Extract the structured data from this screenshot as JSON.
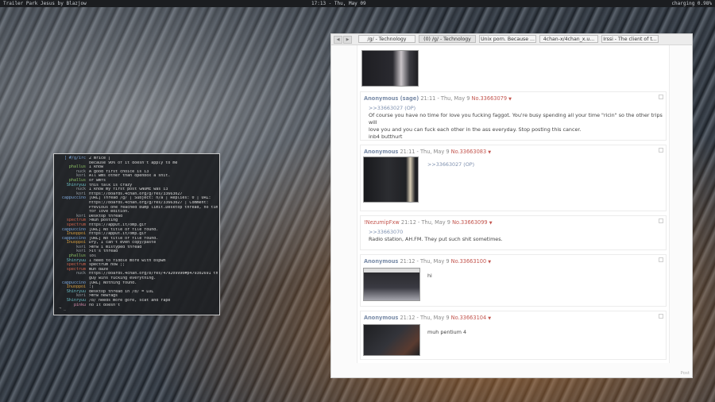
{
  "topbar": {
    "title": "Trailer Park Jesus by Blazjow",
    "clock": "17:13 - Thu, May 09",
    "battery": "charging 0.98%"
  },
  "terminal": {
    "header_nick": "[ ",
    "header_channel": "#/g/irc",
    "header_rest": " ]",
    "lines": [
      {
        "nick": "",
        "nick_color": "white",
        "text": "2 mrice ]"
      },
      {
        "nick": "",
        "nick_color": "white",
        "text": "because 90% of it doesn't apply to me"
      },
      {
        "nick": "phallus",
        "nick_color": "green",
        "text": "I know"
      },
      {
        "nick": "nuck",
        "nick_color": "gray",
        "text": "A good first choice is i3"
      },
      {
        "nick": "kori",
        "nick_color": "gray",
        "text": "All wms other than openbox a shit."
      },
      {
        "nick": "phallus",
        "nick_color": "green",
        "text": "or wmfs"
      },
      {
        "nick": "Shinryuu",
        "nick_color": "cyan",
        "text": "this talk is crazy"
      },
      {
        "nick": "nuck",
        "nick_color": "gray",
        "text": "I know my first post GNOME was i3"
      },
      {
        "nick": "kori",
        "nick_color": "gray",
        "text": "https://boards.4chan.org/g/res/33663027"
      },
      {
        "nick": "cappuccino",
        "nick_color": "blue",
        "text": "[URL] Thread /g/ | Subject: n/a | Replies: 0 | URL:"
      },
      {
        "nick": "",
        "nick_color": "white",
        "text": "https://boards.4chan.org/g/res/33663027 | Comment:"
      },
      {
        "nick": "",
        "nick_color": "white",
        "text": "Previous one reached bump limit.Desktop thread, no time"
      },
      {
        "nick": "",
        "nick_color": "white",
        "text": "for love edition."
      },
      {
        "nick": "kori",
        "nick_color": "gray",
        "text": "Desktop thread"
      },
      {
        "nick": "spectrum",
        "nick_color": "red",
        "text": ">muh posting"
      },
      {
        "nick": "spectrum",
        "nick_color": "red",
        "text": "https://apput.it/omp.gif"
      },
      {
        "nick": "cappuccino",
        "nick_color": "blue",
        "text": "[URL] No title or file found."
      },
      {
        "nick": "Inuoppoi",
        "nick_color": "orange",
        "text": "https://apput.it/omp.gif"
      },
      {
        "nick": "cappuccino",
        "nick_color": "blue",
        "text": "[URL] No title or file found."
      },
      {
        "nick": "Inuoppoi",
        "nick_color": "orange",
        "text": "Dry, I can't even copy/paste"
      },
      {
        "nick": "kori",
        "nick_color": "gray",
        "text": ">mfw i mistyped thread"
      },
      {
        "nick": "kori",
        "nick_color": "gray",
        "text": ">it's thread"
      },
      {
        "nick": "phallus",
        "nick_color": "green",
        "text": "lol"
      },
      {
        "nick": "Shinryuu",
        "nick_color": "cyan",
        "text": "I need to fiddle more with bspwm"
      },
      {
        "nick": "spectrum",
        "nick_color": "red",
        "text": "spectrum how ;;"
      },
      {
        "nick": "spectrum",
        "nick_color": "red",
        "text": "muh daze"
      },
      {
        "nick": "nuck",
        "nick_color": "gray",
        "text": "https://boards.4chan.org/b/res/479209990#p479302691 this"
      },
      {
        "nick": "",
        "nick_color": "white",
        "text": "guy wins fucking everything."
      },
      {
        "nick": "cappuccino",
        "nick_color": "blue",
        "text": "[URL] Nothing found."
      },
      {
        "nick": "Inuoppoi",
        "nick_color": "orange",
        "text": ":("
      },
      {
        "nick": "Shinryuu",
        "nick_color": "cyan",
        "text": "desktop thread in /b/ = LOL"
      },
      {
        "nick": "kori",
        "nick_color": "gray",
        "text": ">mfw newfags"
      },
      {
        "nick": "Shinryuu",
        "nick_color": "cyan",
        "text": "/b/ needs more gore, scat and rape"
      },
      {
        "nick": "pinku",
        "nick_color": "pink",
        "text": "no it doesn't"
      }
    ],
    "prompt": "→ _"
  },
  "browser": {
    "tabs": [
      {
        "label": "/g/ - Technology",
        "active": false
      },
      {
        "label": "(0) /g/ - Technology",
        "active": true
      },
      {
        "label": "Unix porn. Because ...",
        "active": false
      },
      {
        "label": "4chan-x/4chan_x.u...",
        "active": false
      },
      {
        "label": "Irssi - The client of t...",
        "active": false
      }
    ],
    "posts": [
      {
        "name": "Anonymous (sage)",
        "name_red": false,
        "date": "21:11 - Thu, May 9",
        "num": "No.33663079",
        "quote": ">>33663027 (OP)",
        "text": [
          "Of course you have no time for love you fucking faggot. You're busy spending all your time \"ricin\" so the other trips will",
          "love you and you can fuck each other in the ass everyday. Stop posting this cancer.",
          "inb4 butthurt"
        ]
      },
      {
        "name": "Anonymous",
        "name_red": false,
        "date": "21:11 - Thu, May 9",
        "num": "No.33663083",
        "quote": ">>33663027 (OP)",
        "text": []
      },
      {
        "name": "!NezumipFxw",
        "name_red": true,
        "date": "21:12 - Thu, May 9",
        "num": "No.33663099",
        "quote": ">>33663070",
        "text": [
          "Radio station, AH.FM. They put such shit sometimes."
        ]
      },
      {
        "name": "Anonymous",
        "name_red": false,
        "date": "21:12 - Thu, May 9",
        "num": "No.33663100",
        "quote": "",
        "text": [
          "hi"
        ]
      },
      {
        "name": "Anonymous",
        "name_red": false,
        "date": "21:12 - Thu, May 9",
        "num": "No.33663104",
        "quote": "",
        "text": [
          "muh pentium 4"
        ]
      }
    ],
    "footer": "Post",
    "arrow_glyph": "▼",
    "nav_back": "◀",
    "nav_fwd": "▶"
  }
}
